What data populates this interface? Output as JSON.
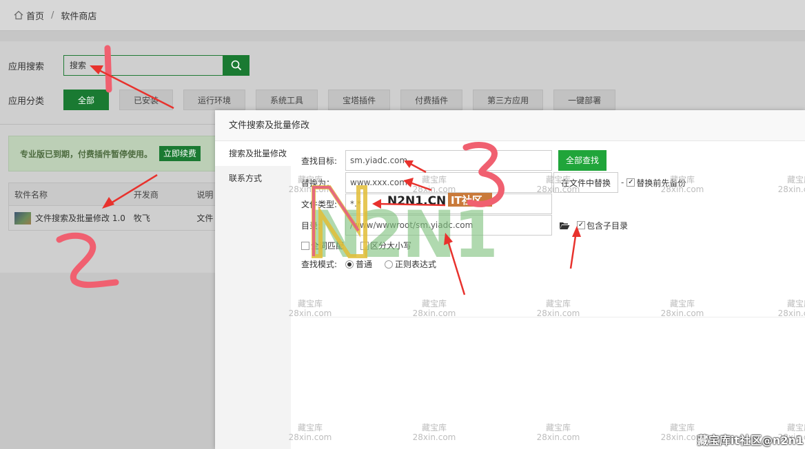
{
  "breadcrumb": {
    "home": "首页",
    "separator": "/",
    "current": "软件商店"
  },
  "search": {
    "label": "应用搜索",
    "value": "搜索"
  },
  "categories": {
    "label": "应用分类",
    "items": [
      {
        "label": "全部",
        "active": true
      },
      {
        "label": "已安装"
      },
      {
        "label": "运行环境"
      },
      {
        "label": "系统工具"
      },
      {
        "label": "宝塔插件"
      },
      {
        "label": "付费插件"
      },
      {
        "label": "第三方应用"
      },
      {
        "label": "一键部署"
      }
    ]
  },
  "notice": {
    "text": "专业版已到期，付费插件暂停使用。",
    "button": "立即续费"
  },
  "table": {
    "headers": [
      "软件名称",
      "开发商",
      "说明"
    ],
    "rows": [
      {
        "name": "文件搜索及批量修改 1.0",
        "developer": "牧飞",
        "desc": "文件"
      }
    ]
  },
  "modal": {
    "title": "文件搜索及批量修改",
    "side_items": [
      "搜索及批量修改",
      "联系方式"
    ],
    "find_label": "查找目标:",
    "find_value": "sm.yiadc.com",
    "find_all_button": "全部查找",
    "replace_label": "替换为：",
    "replace_value": "www.xxx.com",
    "replace_in_files_button": "在文件中替换",
    "dash": "-",
    "backup_label": "替换前先备份",
    "filetype_label": "文件类型:",
    "filetype_value": "*.*",
    "dir_label": "目录:",
    "dir_value": "/www/wwwroot/sm.yiadc.com",
    "include_subdir_label": "包含子目录",
    "whole_word_label": "全词匹配",
    "case_label": "区分大小写",
    "mode_label": "查找模式:",
    "mode_normal": "普通",
    "mode_regex": "正则表达式"
  },
  "watermark": {
    "brand_top": "N2N1.CN",
    "brand_badge": "IT社区",
    "brand_big": "N2N1",
    "tile_line1": "藏宝库",
    "tile_line2": "28xin.com",
    "corner": "藏宝库it社区@n2n1"
  },
  "annotations": {
    "one": "1",
    "two": "2",
    "three": "3"
  },
  "colors": {
    "green": "#20a53a",
    "dark_green": "#1a7a32",
    "annotation_red": "#e8322d",
    "annotation_pink": "#f06070"
  }
}
